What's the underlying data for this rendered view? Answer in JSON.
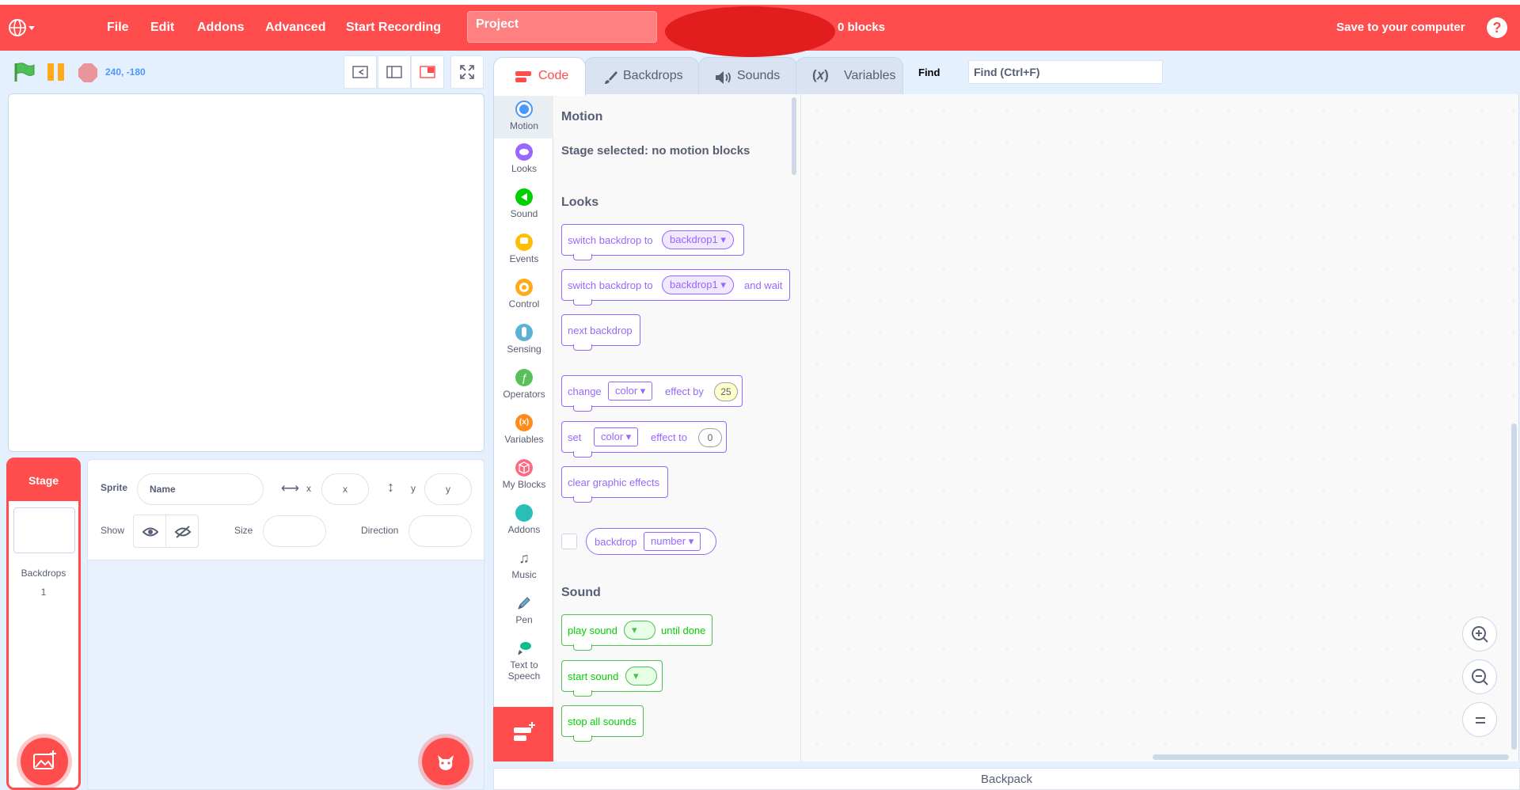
{
  "menubar": {
    "file": "File",
    "edit": "Edit",
    "addons": "Addons",
    "advanced": "Advanced",
    "start_recording": "Start Recording",
    "project_title": "Project",
    "block_count": "0 blocks",
    "save": "Save to your computer",
    "help": "?"
  },
  "stage_header": {
    "coordinates": "240, -180"
  },
  "tabs": {
    "code": "Code",
    "backdrops": "Backdrops",
    "sounds": "Sounds",
    "variables": "Variables"
  },
  "find": {
    "label": "Find",
    "placeholder": "Find (Ctrl+F)"
  },
  "categories": [
    {
      "label": "Motion",
      "color": "#4c97ff"
    },
    {
      "label": "Looks",
      "color": "#9966ff"
    },
    {
      "label": "Sound",
      "color": "#00d000"
    },
    {
      "label": "Events",
      "color": "#ffbf00"
    },
    {
      "label": "Control",
      "color": "#ffab19"
    },
    {
      "label": "Sensing",
      "color": "#5cb1d6"
    },
    {
      "label": "Operators",
      "color": "#59c059"
    },
    {
      "label": "Variables",
      "color": "#ff8c1a"
    },
    {
      "label": "My Blocks",
      "color": "#ff6680"
    },
    {
      "label": "Addons",
      "color": "#29beb8"
    },
    {
      "label": "Music",
      "color": "#0fbd8c"
    },
    {
      "label": "Pen",
      "color": "#0fbd8c"
    },
    {
      "label": "Text to",
      "label2": "Speech",
      "color": "#0fbd8c"
    }
  ],
  "flyout": {
    "motion_heading": "Motion",
    "motion_note": "Stage selected: no motion blocks",
    "looks_heading": "Looks",
    "sound_heading": "Sound",
    "blocks": {
      "switch_backdrop_to": "switch backdrop to",
      "backdrop1": "backdrop1",
      "and_wait": "and wait",
      "next_backdrop": "next backdrop",
      "change": "change",
      "color": "color",
      "effect_by": "effect by",
      "change_value": "25",
      "set": "set",
      "effect_to": "effect to",
      "set_value": "0",
      "clear_graphic_effects": "clear graphic effects",
      "backdrop": "backdrop",
      "number": "number",
      "play_sound": "play sound",
      "until_done": "until done",
      "start_sound": "start sound",
      "stop_all_sounds": "stop all sounds"
    }
  },
  "stage_panel": {
    "title": "Stage",
    "backdrops_label": "Backdrops",
    "backdrops_count": "1"
  },
  "sprite_info": {
    "sprite_label": "Sprite",
    "name_placeholder": "Name",
    "x_label": "x",
    "x_placeholder": "x",
    "y_label": "y",
    "y_placeholder": "y",
    "show_label": "Show",
    "size_label": "Size",
    "direction_label": "Direction"
  },
  "backpack": "Backpack",
  "colors": {
    "brand": "#ff4c4c",
    "looks": "#9966ff",
    "sound": "#00d000"
  }
}
